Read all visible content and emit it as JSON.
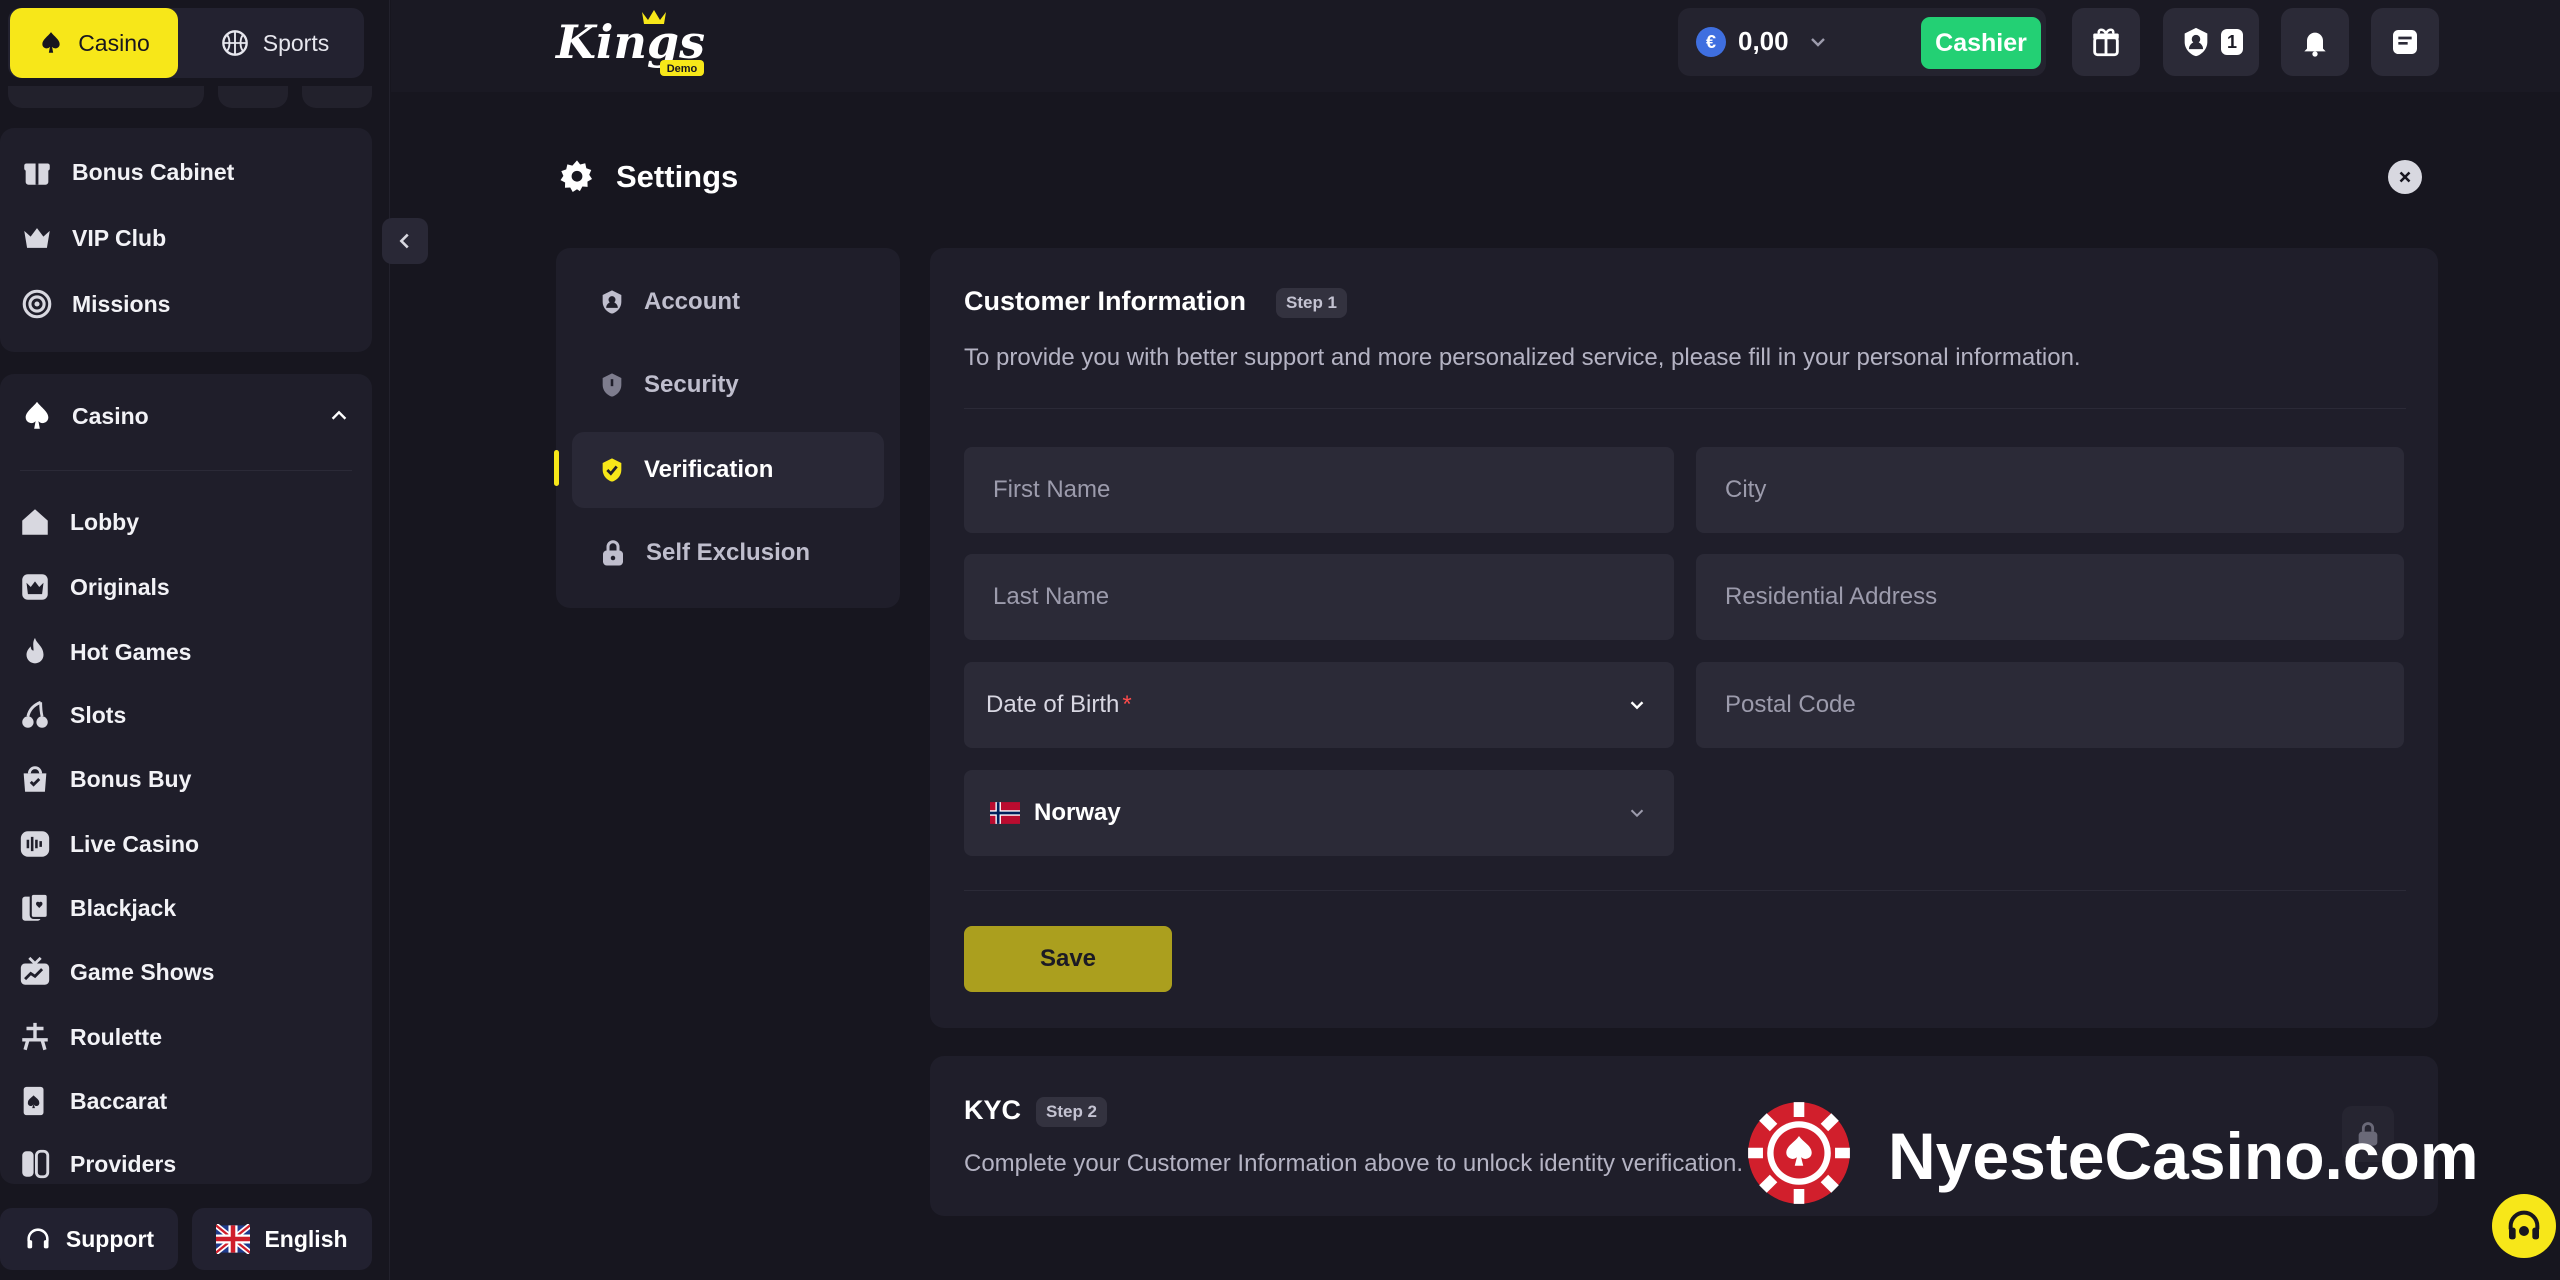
{
  "top_switch": {
    "casino_label": "Casino",
    "sports_label": "Sports"
  },
  "sidebar": {
    "top_items": [
      {
        "label": "Bonus Cabinet",
        "icon": "gift-icon"
      },
      {
        "label": "VIP Club",
        "icon": "crown-icon"
      },
      {
        "label": "Missions",
        "icon": "target-icon"
      }
    ],
    "section_label": "Casino",
    "items": [
      {
        "label": "Lobby",
        "icon": "house-icon"
      },
      {
        "label": "Originals",
        "icon": "crown-icon"
      },
      {
        "label": "Hot Games",
        "icon": "flame-icon"
      },
      {
        "label": "Slots",
        "icon": "cherry-icon"
      },
      {
        "label": "Bonus Buy",
        "icon": "bag-icon"
      },
      {
        "label": "Live Casino",
        "icon": "live-icon"
      },
      {
        "label": "Blackjack",
        "icon": "cards-icon"
      },
      {
        "label": "Game Shows",
        "icon": "tv-icon"
      },
      {
        "label": "Roulette",
        "icon": "roulette-icon"
      },
      {
        "label": "Baccarat",
        "icon": "card-icon"
      },
      {
        "label": "Providers",
        "icon": "providers-icon"
      }
    ],
    "support_label": "Support",
    "language_label": "English"
  },
  "header": {
    "logo_text": "Kings",
    "logo_sub": "Demo",
    "currency_symbol": "€",
    "balance": "0,00",
    "cashier_label": "Cashier",
    "profile_count": "1"
  },
  "settings": {
    "title": "Settings",
    "nav": [
      {
        "label": "Account",
        "icon": "user-icon"
      },
      {
        "label": "Security",
        "icon": "shield-icon"
      },
      {
        "label": "Verification",
        "icon": "shield-check-icon"
      },
      {
        "label": "Self Exclusion",
        "icon": "lock-icon"
      }
    ],
    "active_nav": "Verification"
  },
  "customer_info": {
    "title": "Customer Information",
    "step": "Step 1",
    "description": "To provide you with better support and more personalized service, please fill in your personal information.",
    "fields": {
      "first_name": "First Name",
      "city": "City",
      "last_name": "Last Name",
      "residential_address": "Residential Address",
      "date_of_birth": "Date of Birth",
      "date_of_birth_required": "*",
      "postal_code": "Postal Code",
      "country": "Norway"
    },
    "save_label": "Save"
  },
  "kyc": {
    "title": "KYC",
    "step": "Step 2",
    "description": "Complete your Customer Information above to unlock identity verification."
  },
  "watermark": {
    "text": "NyesteCasino.com"
  },
  "colors": {
    "accent": "#f7e719",
    "cashier": "#23d074",
    "background": "#17161f",
    "panel": "#1f1e2a",
    "field": "#2b2a37"
  }
}
